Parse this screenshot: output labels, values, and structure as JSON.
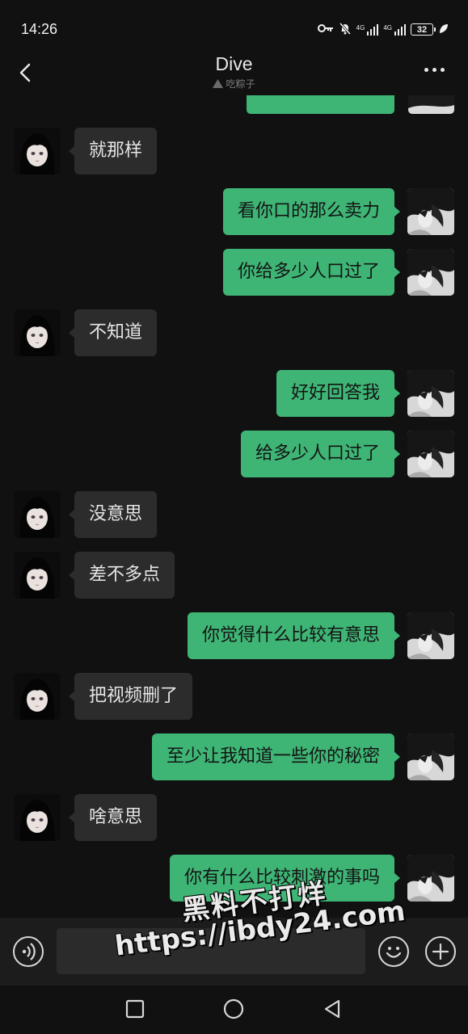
{
  "status": {
    "time": "14:26",
    "network_1": "4G",
    "network_2": "4G",
    "battery": "32"
  },
  "header": {
    "title": "Dive",
    "subtitle": "吃粽子"
  },
  "messages": [
    {
      "side": "in",
      "text": "就那样"
    },
    {
      "side": "out",
      "text": "看你口的那么卖力"
    },
    {
      "side": "out",
      "text": "你给多少人口过了"
    },
    {
      "side": "in",
      "text": "不知道"
    },
    {
      "side": "out",
      "text": "好好回答我"
    },
    {
      "side": "out",
      "text": "给多少人口过了"
    },
    {
      "side": "in",
      "text": "没意思"
    },
    {
      "side": "in",
      "text": "差不多点"
    },
    {
      "side": "out",
      "text": "你觉得什么比较有意思"
    },
    {
      "side": "in",
      "text": "把视频删了"
    },
    {
      "side": "out",
      "text": "至少让我知道一些你的秘密"
    },
    {
      "side": "in",
      "text": "啥意思"
    },
    {
      "side": "out",
      "text": "你有什么比较刺激的事吗"
    }
  ],
  "input": {
    "value": "",
    "placeholder": ""
  },
  "watermark": {
    "line1": "黑料不打烊",
    "line2": "https://ibdy24.com"
  },
  "colors": {
    "background": "#111111",
    "outgoing_bubble": "#3eb575",
    "incoming_bubble": "#2c2c2c",
    "input_bar": "#1c1c1c"
  },
  "icons": [
    "back-arrow-icon",
    "more-dots-icon",
    "voice-icon",
    "emoji-icon",
    "plus-icon",
    "nav-square-icon",
    "nav-circle-icon",
    "nav-back-triangle-icon"
  ]
}
